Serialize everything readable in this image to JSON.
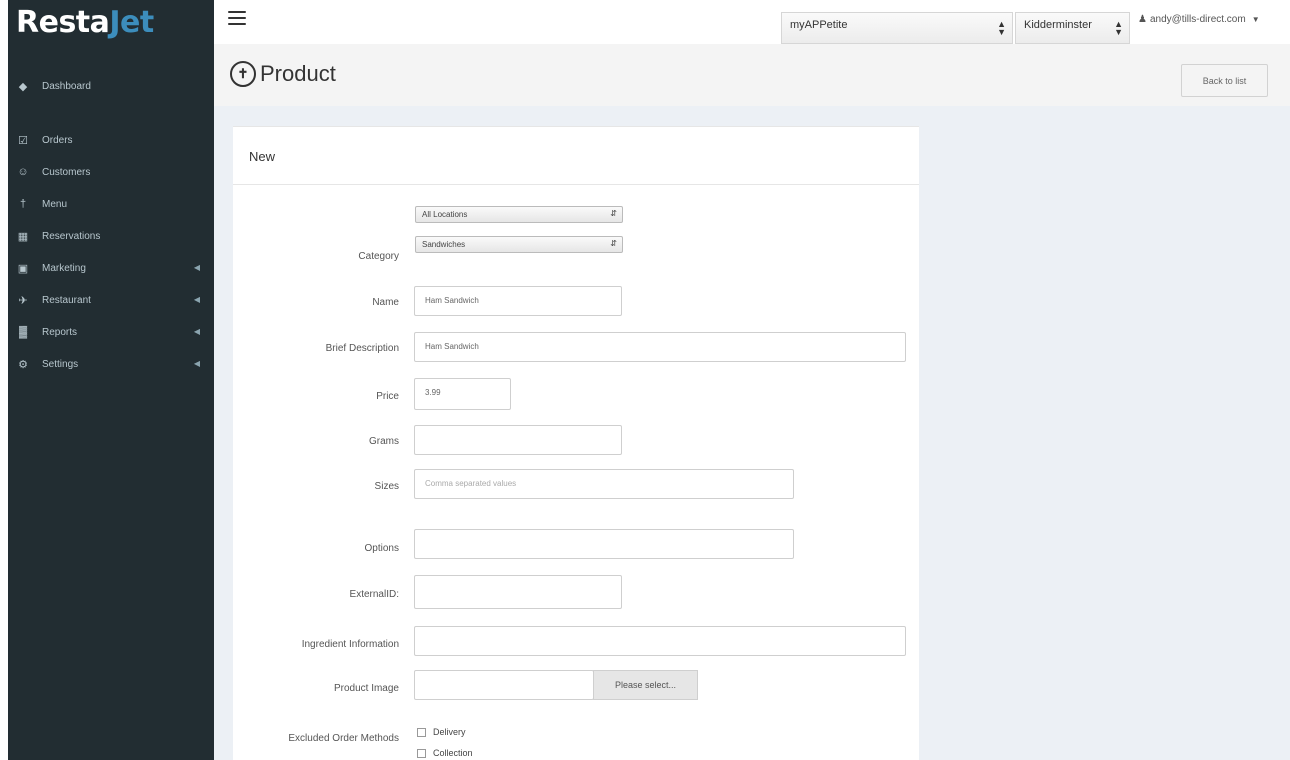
{
  "brand": {
    "part1": "Resta",
    "part2": "Jet"
  },
  "sidebar": {
    "items": [
      {
        "label": "Dashboard",
        "icon": "dashboard-icon",
        "glyph": "◆"
      },
      {
        "label": "Orders",
        "icon": "shopping-cart-icon",
        "glyph": "☑"
      },
      {
        "label": "Customers",
        "icon": "users-icon",
        "glyph": "☺"
      },
      {
        "label": "Menu",
        "icon": "cutlery-icon",
        "glyph": "†"
      },
      {
        "label": "Reservations",
        "icon": "calendar-icon",
        "glyph": "▦"
      },
      {
        "label": "Marketing",
        "icon": "bullhorn-icon",
        "glyph": "▣"
      },
      {
        "label": "Restaurant",
        "icon": "plane-icon",
        "glyph": "✈"
      },
      {
        "label": "Reports",
        "icon": "bar-chart-icon",
        "glyph": "▓"
      },
      {
        "label": "Settings",
        "icon": "gear-icon",
        "glyph": "⚙"
      }
    ]
  },
  "topbar": {
    "app_select": "myAPPetite",
    "location_select": "Kidderminster",
    "user_email": "andy@tills-direct.com"
  },
  "page": {
    "title": "Product",
    "back_button": "Back to list"
  },
  "form": {
    "header": "New",
    "location_select": "All Locations",
    "category_label": "Category",
    "category_select": "Sandwiches",
    "name_label": "Name",
    "name_value": "Ham Sandwich",
    "brief_label": "Brief Description",
    "brief_value": "Ham Sandwich",
    "price_label": "Price",
    "price_value": "3.99",
    "grams_label": "Grams",
    "grams_value": "",
    "sizes_label": "Sizes",
    "sizes_placeholder": "Comma separated values",
    "options_label": "Options",
    "options_value": "",
    "external_label": "ExternalID:",
    "external_value": "",
    "ingredient_label": "Ingredient Information",
    "ingredient_value": "",
    "image_label": "Product Image",
    "image_button": "Please select...",
    "excluded_label": "Excluded Order Methods",
    "excluded_options": [
      "Delivery",
      "Collection"
    ]
  },
  "colors": {
    "sidebar_bg": "#222d32",
    "brand_accent": "#3c8dbc",
    "content_bg": "#ecf0f5"
  }
}
